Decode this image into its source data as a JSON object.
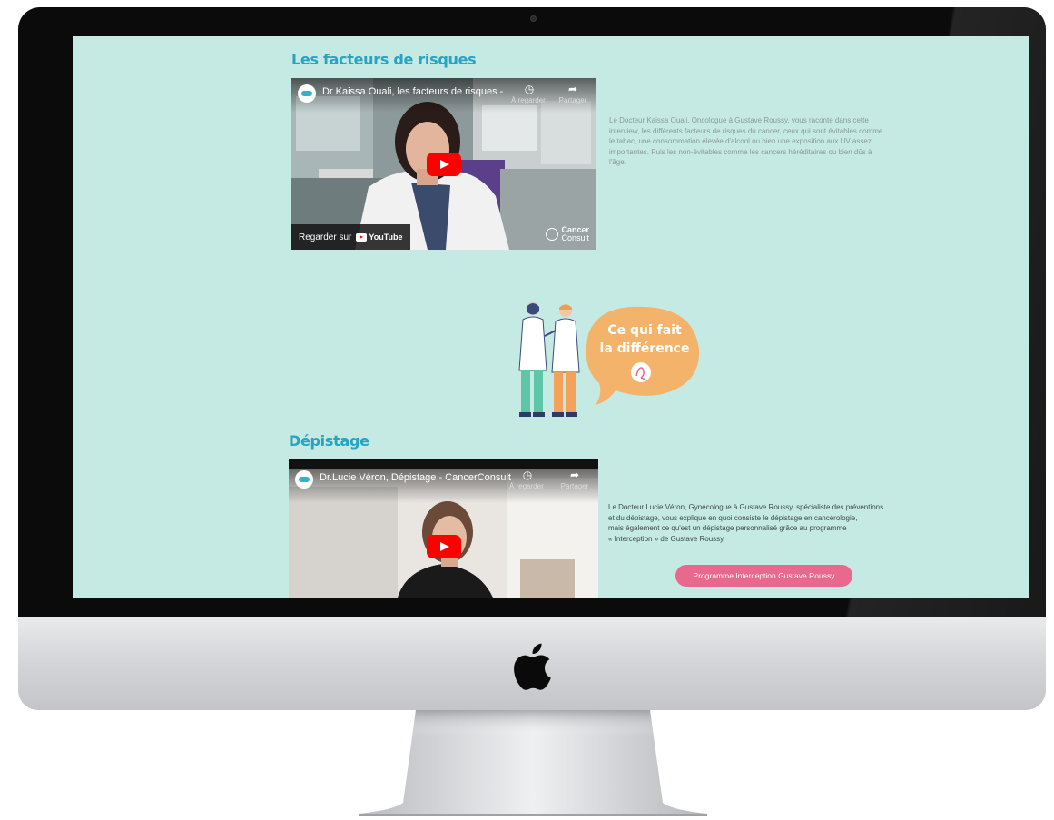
{
  "section1": {
    "title": "Les facteurs de risques",
    "video": {
      "title": "Dr Kaissa Ouali, les facteurs de risques - Ca...",
      "watch_later": "À regarder ...",
      "share": "Partager",
      "watch_on": "Regarder sur",
      "platform": "YouTube",
      "brand_line1": "Cancer",
      "brand_line2": "Consult"
    },
    "description": [
      "Le Docteur Kaissa Ouali, Oncologue à Gustave Roussy, vous raconte dans cette",
      "interview, les différents facteurs de risques du cancer, ceux qui sont évitables comme",
      "le tabac, une consommation élevée d'alcool ou bien une exposition aux UV assez",
      "importantes. Puis les non-évitables comme les cancers héréditaires ou bien dûs à",
      "l'âge."
    ]
  },
  "illustration": {
    "bubble_line1": "Ce qui fait",
    "bubble_line2": "la différence"
  },
  "section2": {
    "title": "Dépistage",
    "video": {
      "title": "Dr.Lucie Véron, Dépistage - CancerConsult",
      "watch_later": "À regarder ...",
      "share": "Partager"
    },
    "description": [
      "Le Docteur Lucie Véron, Gynécologue à Gustave Roussy, spécialiste des préventions",
      "et du dépistage, vous explique en quoi consiste le dépistage en cancérologie,",
      "mais également ce qu'est un dépistage personnalisé grâce au programme",
      "« Interception » de Gustave Roussy."
    ],
    "button_label": "Programme Interception Gustave Roussy"
  },
  "colors": {
    "background": "#c5e9e3",
    "title": "#27a3c3",
    "button": "#e9688e",
    "bubble": "#f4b36a"
  }
}
